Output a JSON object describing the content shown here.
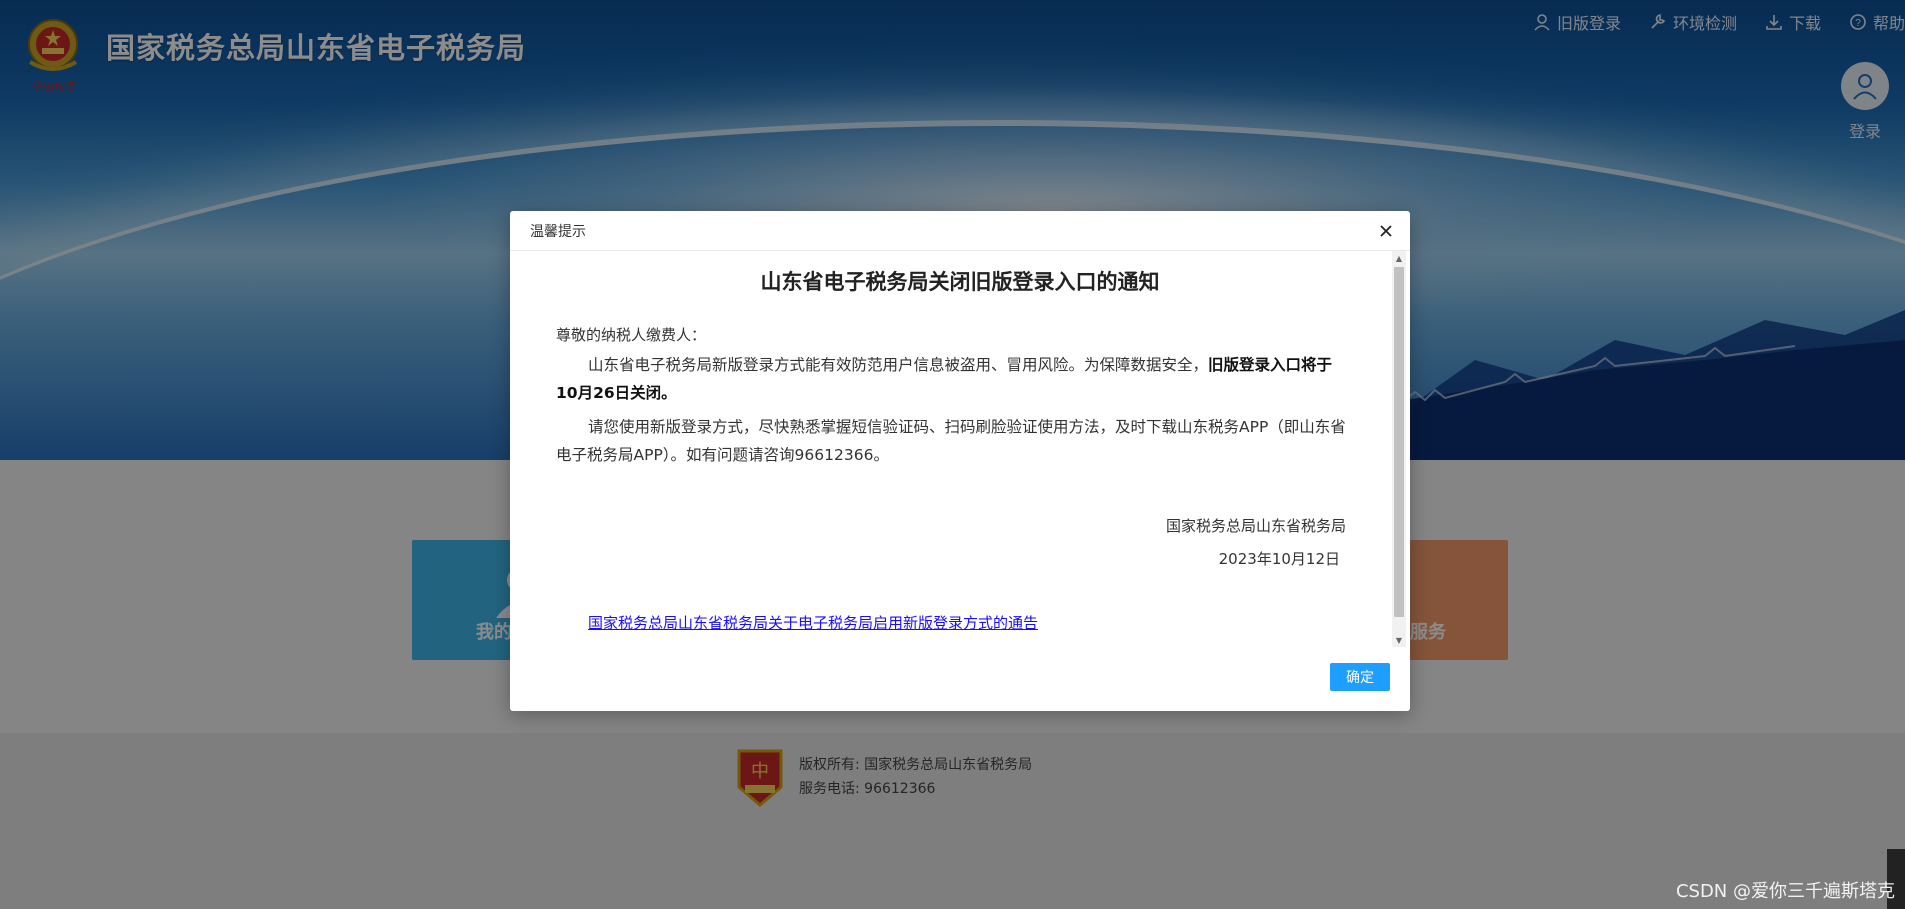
{
  "header": {
    "site_title": "国家税务总局山东省电子税务局",
    "nav": [
      {
        "label": "旧版登录",
        "icon": "user-icon"
      },
      {
        "label": "环境检测",
        "icon": "wrench-icon"
      },
      {
        "label": "下载",
        "icon": "download-icon"
      },
      {
        "label": "帮助",
        "icon": "help-icon"
      }
    ],
    "login_label": "登录"
  },
  "cards": {
    "left_label": "我的",
    "right_label": "服务"
  },
  "footer": {
    "copyright": "版权所有: 国家税务总局山东省税务局",
    "phone": "服务电话: 96612366"
  },
  "modal": {
    "header_title": "温馨提示",
    "notice_title": "山东省电子税务局关闭旧版登录入口的通知",
    "salutation": "尊敬的纳税人缴费人：",
    "para1_text": "山东省电子税务局新版登录方式能有效防范用户信息被盗用、冒用风险。为保障数据安全，",
    "para1_bold": "旧版登录入口将于10月26日关闭。",
    "para2": "请您使用新版登录方式，尽快熟悉掌握短信验证码、扫码刷脸验证使用方法，及时下载山东税务APP（即山东省电子税务局APP）。如有问题请咨询96612366。",
    "sign_org": "国家税务总局山东省税务局",
    "sign_date": "2023年10月12日",
    "link": "国家税务总局山东省税务局关于电子税务局启用新版登录方式的通告",
    "ok_label": "确定"
  },
  "watermark": "CSDN @爱你三千遍斯塔克",
  "colors": {
    "ok_button": "#1e9fff",
    "link": "#1a0dff",
    "card_left": "#3fb6e8",
    "card_right": "#f29a6c"
  }
}
